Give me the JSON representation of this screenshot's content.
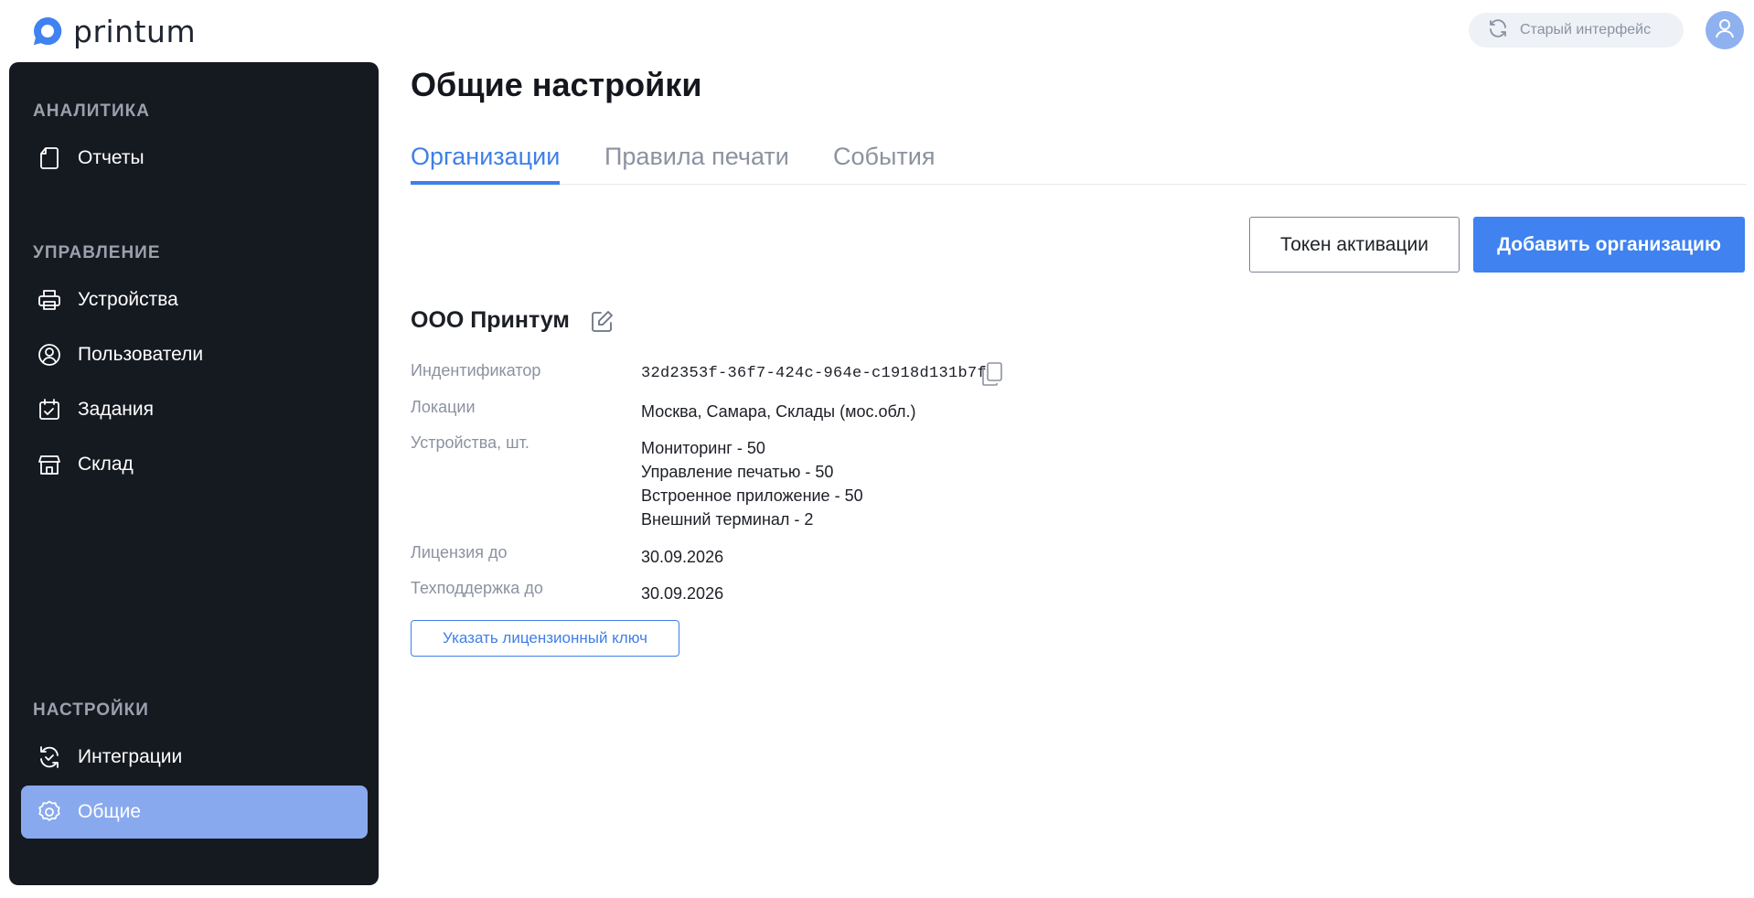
{
  "brand": {
    "name": "printum",
    "accent": "#3f82f0"
  },
  "header": {
    "old_interface_label": "Старый интерфейс",
    "old_interface_icon": "refresh-icon",
    "avatar_icon": "user-icon"
  },
  "sidebar": {
    "sections": [
      {
        "title": "АНАЛИТИКА",
        "items": [
          {
            "label": "Отчеты",
            "icon": "document-icon"
          }
        ]
      },
      {
        "title": "УПРАВЛЕНИЕ",
        "items": [
          {
            "label": "Устройства",
            "icon": "printer-icon"
          },
          {
            "label": "Пользователи",
            "icon": "user-circle-icon"
          },
          {
            "label": "Задания",
            "icon": "calendar-check-icon"
          },
          {
            "label": "Склад",
            "icon": "store-icon"
          }
        ]
      },
      {
        "title": "НАСТРОЙКИ",
        "items": [
          {
            "label": "Интеграции",
            "icon": "sync-check-icon"
          },
          {
            "label": "Общие",
            "icon": "gear-icon",
            "active": true
          }
        ]
      }
    ]
  },
  "main": {
    "title": "Общие настройки",
    "tabs": [
      {
        "label": "Организации",
        "active": true
      },
      {
        "label": "Правила печати"
      },
      {
        "label": "События"
      }
    ],
    "actions": {
      "activation_token": "Токен активации",
      "add_org": "Добавить организацию"
    },
    "org": {
      "name": "ООО Принтум",
      "fields": {
        "id_label": "Индентификатор",
        "id_value": "32d2353f-36f7-424c-964e-c1918d131b7f",
        "locations_label": "Локации",
        "locations_value": "Москва, Самара, Склады (мос.обл.)",
        "devices_label": "Устройства, шт.",
        "devices_values": [
          "Мониторинг - 50",
          "Управление печатью - 50",
          "Встроенное приложение - 50",
          "Внешний терминал - 2"
        ],
        "license_label": "Лицензия до",
        "license_value": "30.09.2026",
        "support_label": "Техподдержка до",
        "support_value": "30.09.2026"
      },
      "license_key_button": "Указать лицензионный ключ"
    }
  }
}
